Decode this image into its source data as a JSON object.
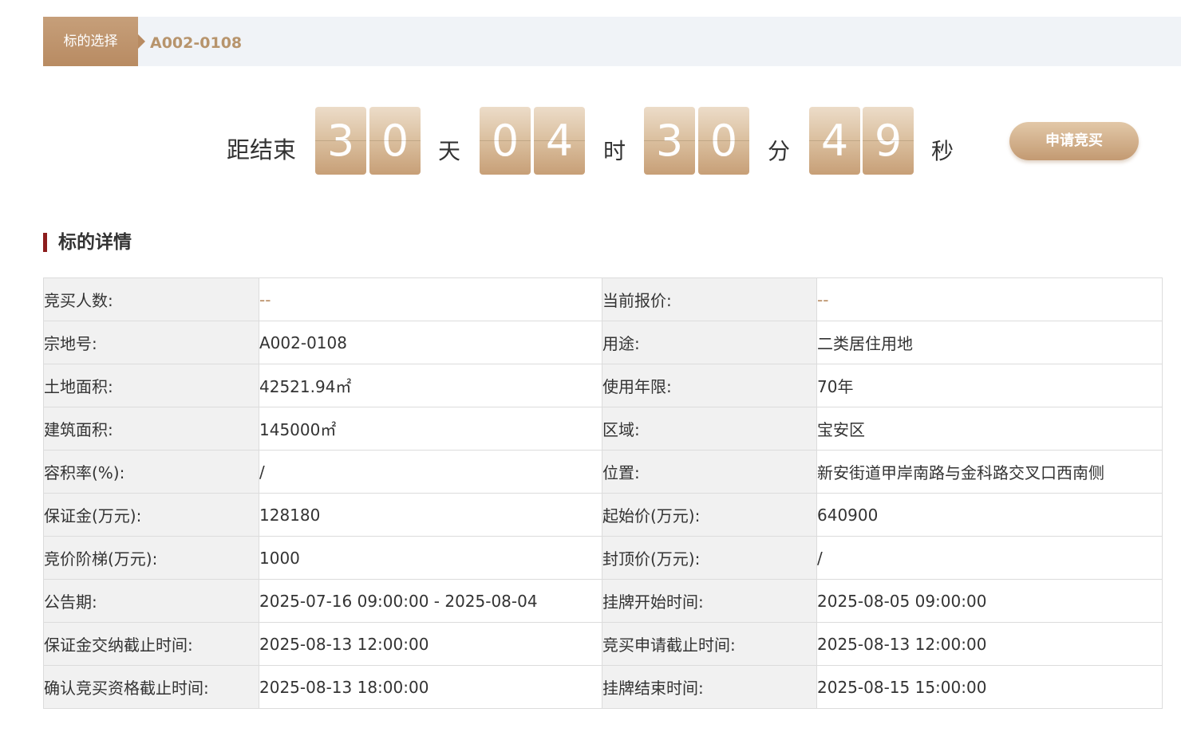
{
  "breadcrumb": {
    "tag": "标的选择",
    "code": "A002-0108"
  },
  "countdown": {
    "label": "距结束",
    "days": [
      "3",
      "0"
    ],
    "day_unit": "天",
    "hours": [
      "0",
      "4"
    ],
    "hour_unit": "时",
    "minutes": [
      "3",
      "0"
    ],
    "minute_unit": "分",
    "seconds": [
      "4",
      "9"
    ],
    "second_unit": "秒"
  },
  "apply_button": "申请竞买",
  "section_title": "标的详情",
  "colors": {
    "accent": "#b88b62",
    "section_bar": "#8d1d1d",
    "label_bg": "#f1f1f1"
  },
  "details": [
    {
      "l1": "竞买人数:",
      "v1": "--",
      "l2": "当前报价:",
      "v2": "--"
    },
    {
      "l1": "宗地号:",
      "v1": "A002-0108",
      "l2": "用途:",
      "v2": "二类居住用地"
    },
    {
      "l1": "土地面积:",
      "v1": "42521.94㎡",
      "l2": "使用年限:",
      "v2": "70年"
    },
    {
      "l1": "建筑面积:",
      "v1": "145000㎡",
      "l2": "区域:",
      "v2": "宝安区"
    },
    {
      "l1": "容积率(%):",
      "v1": "/",
      "l2": "位置:",
      "v2": "新安街道甲岸南路与金科路交叉口西南侧"
    },
    {
      "l1": "保证金(万元):",
      "v1": "128180",
      "l2": "起始价(万元):",
      "v2": "640900"
    },
    {
      "l1": "竞价阶梯(万元):",
      "v1": "1000",
      "l2": "封顶价(万元):",
      "v2": "/"
    },
    {
      "l1": "公告期:",
      "v1": "2025-07-16 09:00:00 - 2025-08-04",
      "l2": "挂牌开始时间:",
      "v2": "2025-08-05 09:00:00"
    },
    {
      "l1": "保证金交纳截止时间:",
      "v1": "2025-08-13 12:00:00",
      "l2": "竞买申请截止时间:",
      "v2": "2025-08-13 12:00:00"
    },
    {
      "l1": "确认竞买资格截止时间:",
      "v1": "2025-08-13 18:00:00",
      "l2": "挂牌结束时间:",
      "v2": "2025-08-15 15:00:00"
    }
  ]
}
